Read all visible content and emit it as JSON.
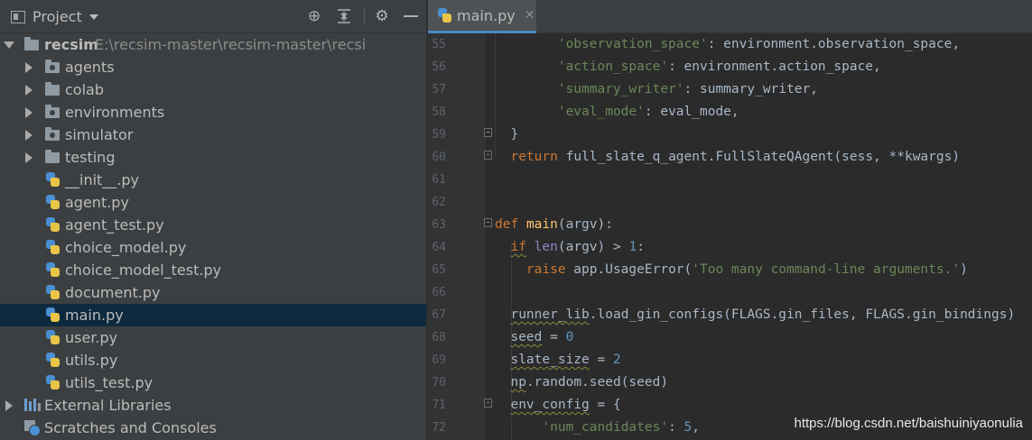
{
  "project_panel": {
    "title": "Project",
    "toolbar": {
      "locate_icon": "crosshair-icon",
      "collapse_icon": "collapse-all-icon",
      "settings_icon": "gear-icon",
      "hide_icon": "minimize-icon"
    },
    "root": {
      "name": "recsim",
      "path": "E:\\recsim-master\\recsim-master\\recsi"
    },
    "folders": [
      "agents",
      "colab",
      "environments",
      "simulator",
      "testing"
    ],
    "files": [
      "__init__.py",
      "agent.py",
      "agent_test.py",
      "choice_model.py",
      "choice_model_test.py",
      "document.py",
      "main.py",
      "user.py",
      "utils.py",
      "utils_test.py"
    ],
    "selected_file": "main.py",
    "external_libraries": "External Libraries",
    "scratches": "Scratches and Consoles"
  },
  "editor": {
    "tab": {
      "label": "main.py",
      "close": "✕"
    },
    "line_numbers": [
      "55",
      "56",
      "57",
      "58",
      "59",
      "60",
      "61",
      "62",
      "63",
      "64",
      "65",
      "66",
      "67",
      "68",
      "69",
      "70",
      "71",
      "72"
    ],
    "code": {
      "l55_key": "'observation_space'",
      "l55_rest": ": environment.observation_space,",
      "l56_key": "'action_space'",
      "l56_rest": ": environment.action_space,",
      "l57_key": "'summary_writer'",
      "l57_rest": ": summary_writer,",
      "l58_key": "'eval_mode'",
      "l58_rest": ": eval_mode,",
      "l59": "}",
      "l60_kw": "return",
      "l60_rest": " full_slate_q_agent.FullSlateQAgent(sess, **kwargs)",
      "l63_kw": "def",
      "l63_fn": "main",
      "l63_rest": "(argv):",
      "l64_kw": "if",
      "l64_fn": "len",
      "l64_mid": "(argv) > ",
      "l64_num": "1",
      "l64_end": ":",
      "l65_kw": "raise",
      "l65_mid": " app.UsageError(",
      "l65_str": "'Too many command-line arguments.'",
      "l65_end": ")",
      "l67_a": "runner_lib",
      "l67_b": ".load_gin_configs(FLAGS.gin_files, FLAGS.gin_bindings)",
      "l68_var": "seed",
      "l68_mid": " = ",
      "l68_num": "0",
      "l69_var": "slate_size",
      "l69_mid": " = ",
      "l69_num": "2",
      "l70_a": "np",
      "l70_b": ".random.seed(seed)",
      "l71_var": "env_config",
      "l71_rest": " = {",
      "l72_key": "'num_candidates'",
      "l72_mid": ": ",
      "l72_num": "5",
      "l72_end": ","
    },
    "syntax_colors": {
      "keyword": "#cc7832",
      "string": "#6a8759",
      "number": "#6897bb",
      "function": "#ffc66d",
      "default": "#a9b7c6"
    }
  },
  "watermark": "https://blog.csdn.net/baishuiniyaonulia"
}
